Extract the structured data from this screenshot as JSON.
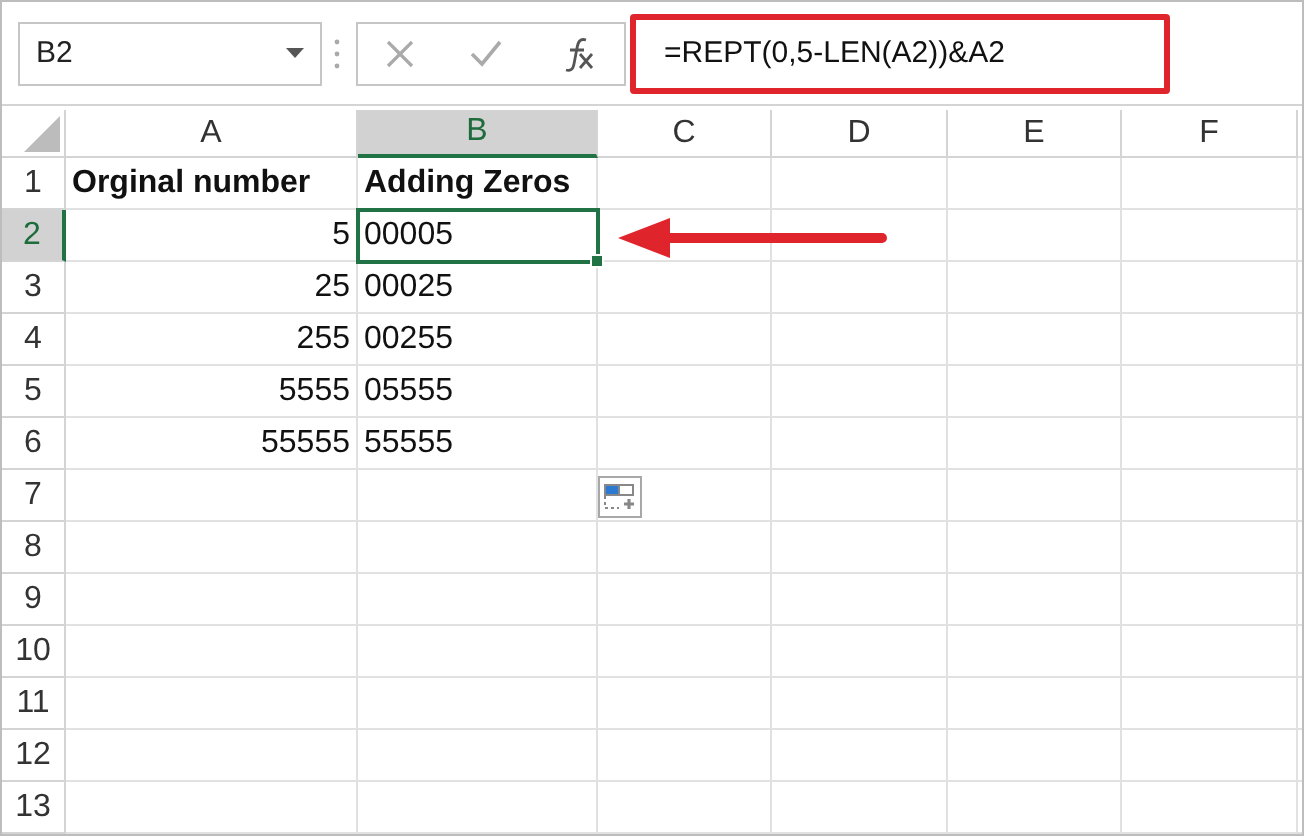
{
  "name_box": {
    "value": "B2"
  },
  "formula_bar": {
    "formula": "=REPT(0,5-LEN(A2))&A2",
    "highlighted": true
  },
  "columns": [
    {
      "label": "A",
      "selected": false
    },
    {
      "label": "B",
      "selected": true
    },
    {
      "label": "C",
      "selected": false
    },
    {
      "label": "D",
      "selected": false
    },
    {
      "label": "E",
      "selected": false
    },
    {
      "label": "F",
      "selected": false
    }
  ],
  "rows": [
    {
      "label": "1",
      "selected": false,
      "kind": "header",
      "cells": [
        {
          "text": "Orginal number",
          "kind": "text",
          "selected": false
        },
        {
          "text": "Adding Zeros",
          "kind": "text",
          "selected": false
        }
      ]
    },
    {
      "label": "2",
      "selected": true,
      "kind": "data",
      "cells": [
        {
          "text": "5",
          "kind": "number",
          "selected": false
        },
        {
          "text": "00005",
          "kind": "text",
          "selected": true
        }
      ]
    },
    {
      "label": "3",
      "selected": false,
      "kind": "data",
      "cells": [
        {
          "text": "25",
          "kind": "number",
          "selected": false
        },
        {
          "text": "00025",
          "kind": "text",
          "selected": false
        }
      ]
    },
    {
      "label": "4",
      "selected": false,
      "kind": "data",
      "cells": [
        {
          "text": "255",
          "kind": "number",
          "selected": false
        },
        {
          "text": "00255",
          "kind": "text",
          "selected": false
        }
      ]
    },
    {
      "label": "5",
      "selected": false,
      "kind": "data",
      "cells": [
        {
          "text": "5555",
          "kind": "number",
          "selected": false
        },
        {
          "text": "05555",
          "kind": "text",
          "selected": false
        }
      ]
    },
    {
      "label": "6",
      "selected": false,
      "kind": "data",
      "cells": [
        {
          "text": "55555",
          "kind": "number",
          "selected": false
        },
        {
          "text": "55555",
          "kind": "text",
          "selected": false
        }
      ]
    },
    {
      "label": "7",
      "selected": false
    },
    {
      "label": "8",
      "selected": false
    },
    {
      "label": "9",
      "selected": false
    },
    {
      "label": "10",
      "selected": false
    },
    {
      "label": "11",
      "selected": false
    },
    {
      "label": "12",
      "selected": false
    },
    {
      "label": "13",
      "selected": false
    }
  ],
  "paste_options": true,
  "pointer_arrow": true
}
